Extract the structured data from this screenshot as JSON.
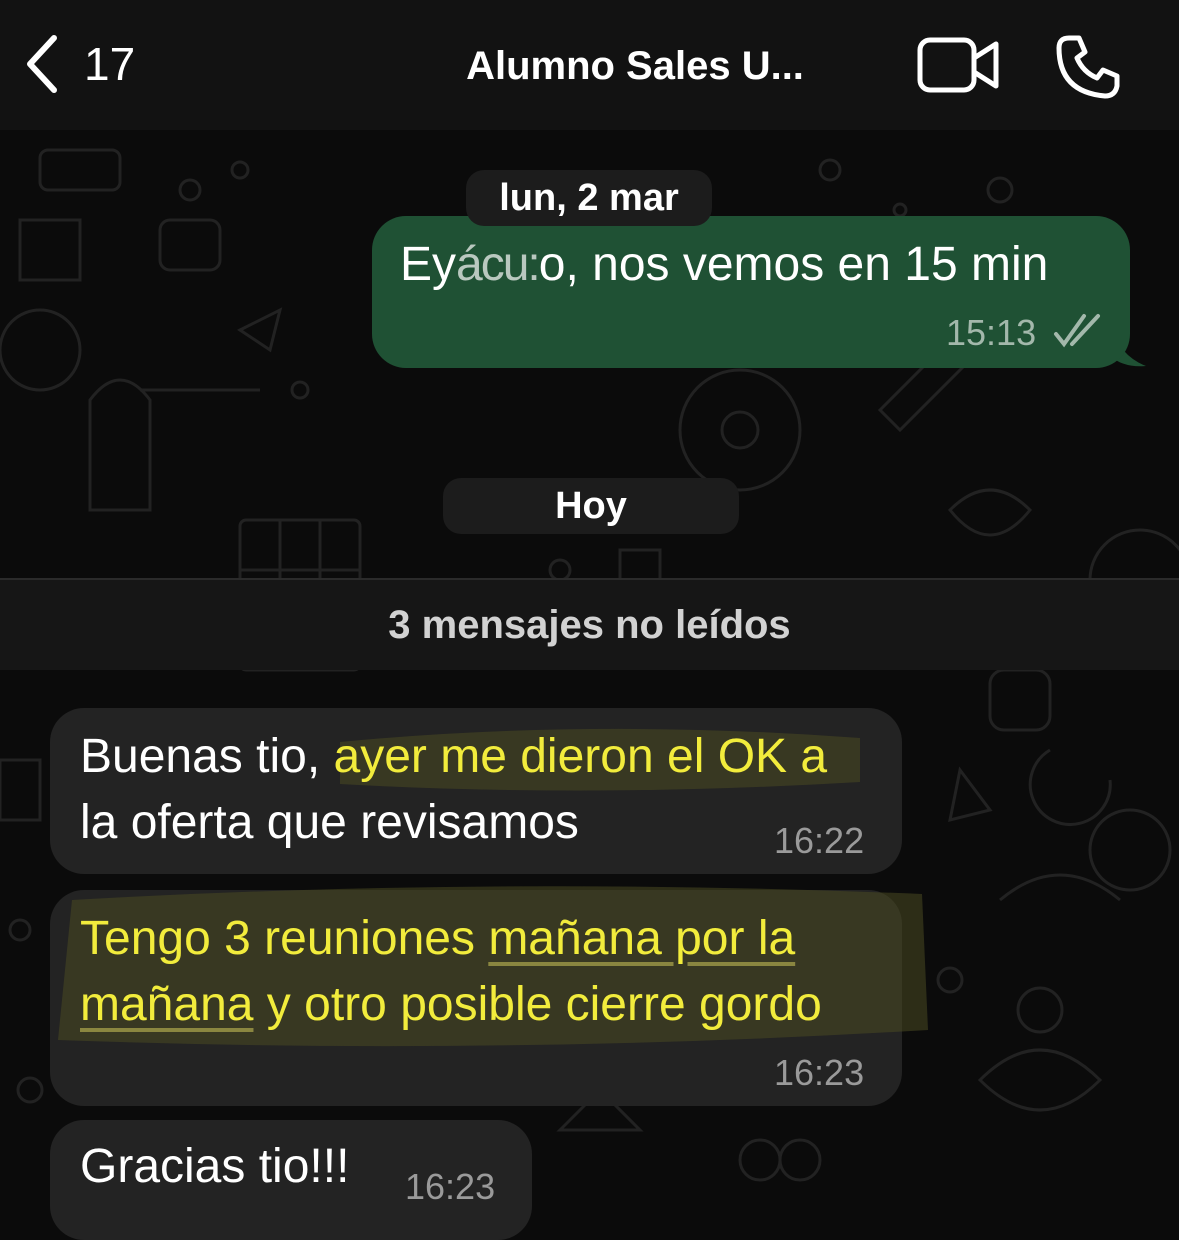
{
  "header": {
    "back_count": "17",
    "title": "Alumno Sales U...",
    "icons": [
      "chevron-left-icon",
      "video-camera-icon",
      "phone-icon"
    ]
  },
  "separators": {
    "date_1": "lun, 2 mar",
    "date_2": "Hoy",
    "unread": "3 mensajes no leídos"
  },
  "messages": [
    {
      "direction": "out",
      "text_a": "Ey",
      "text_smudged": "ácu:",
      "text_b": "o, nos vemos en 15 min",
      "time": "15:13",
      "status": "read"
    },
    {
      "direction": "in",
      "line1_plain": "Buenas tio, ",
      "line1_highlight": "ayer me dieron el OK a",
      "line2": "la oferta que revisamos",
      "time": "16:22"
    },
    {
      "direction": "in",
      "line1_a": "Tengo 3 reuniones ",
      "line1_link": "mañana por la",
      "line2_link": "mañana",
      "line2_b": " y otro posible cierre gordo",
      "time": "16:23"
    },
    {
      "direction": "in",
      "text": "Gracias tio!!!",
      "time": "16:23"
    }
  ],
  "colors": {
    "background": "#0b0b0b",
    "header": "#121212",
    "outgoing_bubble": "#1f5134",
    "incoming_bubble": "#232323",
    "highlight_text": "#f2ec3c"
  }
}
